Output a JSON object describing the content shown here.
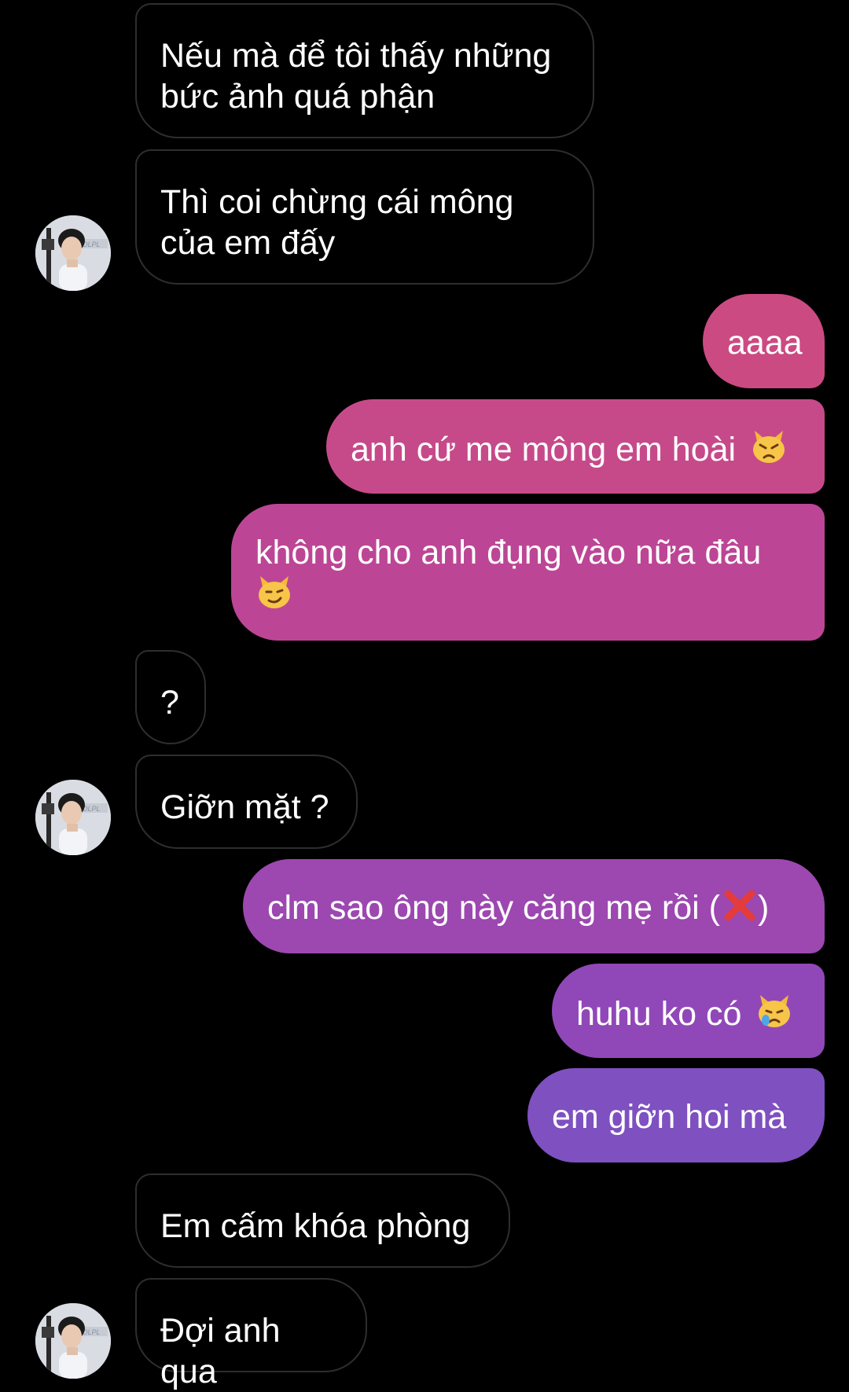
{
  "messages": [
    {
      "id": "m1",
      "sender": "them",
      "text": "Nếu mà để tôi thấy những bức ảnh quá phận"
    },
    {
      "id": "m2",
      "sender": "them",
      "text": "Thì coi chừng cái mông của em đấy"
    },
    {
      "id": "m3",
      "sender": "me",
      "text": "aaaa"
    },
    {
      "id": "m4",
      "sender": "me",
      "text": "anh cứ me mông em hoài",
      "emoji": "pouting-cat"
    },
    {
      "id": "m5",
      "sender": "me",
      "text": "không cho anh đụng vào nữa đâu",
      "emoji": "smirking-cat"
    },
    {
      "id": "m6",
      "sender": "them",
      "text": "?"
    },
    {
      "id": "m7",
      "sender": "them",
      "text": "Giỡn mặt ?"
    },
    {
      "id": "m8",
      "sender": "me",
      "text": "clm sao ông này căng mẹ rồi (",
      "emoji": "cross-mark",
      "suffix": ")"
    },
    {
      "id": "m9",
      "sender": "me",
      "text": "huhu ko có",
      "emoji": "crying-cat"
    },
    {
      "id": "m10",
      "sender": "me",
      "text": "em giỡn hoi mà"
    },
    {
      "id": "m11",
      "sender": "them",
      "text": "Em cấm khóa phòng"
    },
    {
      "id": "m12",
      "sender": "them",
      "text": "Đợi anh qua"
    }
  ],
  "colors": {
    "background": "#000000",
    "incoming_border": "#2e2e2e",
    "outgoing_gradient_top": "#cc4a82",
    "outgoing_gradient_bottom": "#7b4fc0"
  },
  "avatar": {
    "alt_icon": "contact-avatar"
  }
}
